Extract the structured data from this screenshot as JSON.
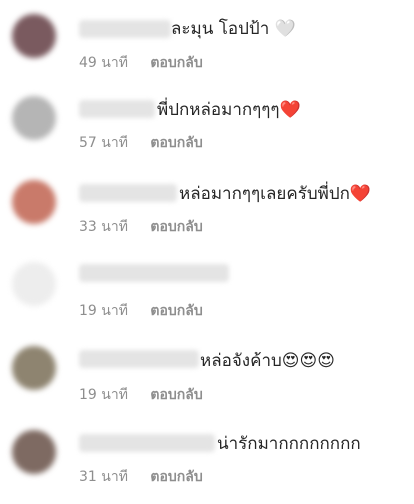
{
  "comments": [
    {
      "text": "ละมุน โอปป้า 🤍",
      "time": "49 นาที",
      "reply": "ตอบกลับ",
      "avatar_color": "#7a5a5f"
    },
    {
      "text": "พี่ปกหล่อมากๆๆๆ❤️",
      "time": "57 นาที",
      "reply": "ตอบกลับ",
      "avatar_color": "#b5b5b5"
    },
    {
      "text": "หล่อมากๆๆเลยครับพี่ปก❤️",
      "time": "33 นาที",
      "reply": "ตอบกลับ",
      "avatar_color": "#c97a6a"
    },
    {
      "text": "",
      "time": "19 นาที",
      "reply": "ตอบกลับ",
      "avatar_color": "#ededed"
    },
    {
      "text": "หล่อจังค้าบ😍😍😍",
      "time": "19 นาที",
      "reply": "ตอบกลับ",
      "avatar_color": "#8e8470"
    },
    {
      "text": "น่ารักมากกกกกกกก",
      "time": "31 นาที",
      "reply": "ตอบกลับ",
      "avatar_color": "#7e6a62"
    }
  ]
}
